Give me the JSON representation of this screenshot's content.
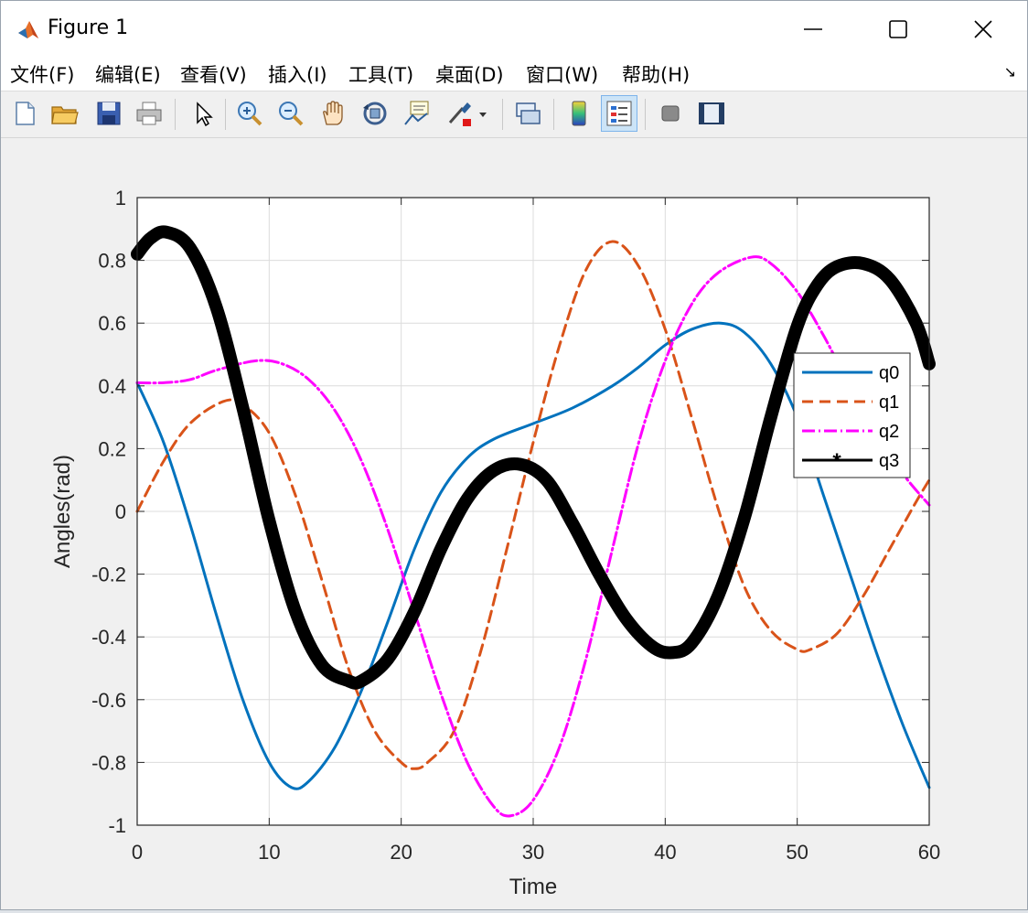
{
  "window": {
    "title": "Figure 1"
  },
  "menu": [
    {
      "label": "文件(F)",
      "key": "F"
    },
    {
      "label": "编辑(E)",
      "key": "E"
    },
    {
      "label": "查看(V)",
      "key": "V"
    },
    {
      "label": "插入(I)",
      "key": "I"
    },
    {
      "label": "工具(T)",
      "key": "T"
    },
    {
      "label": "桌面(D)",
      "key": "D"
    },
    {
      "label": "窗口(W)",
      "key": "W"
    },
    {
      "label": "帮助(H)",
      "key": "H"
    }
  ],
  "toolbar": [
    "new-figure-icon",
    "open-file-icon",
    "save-icon",
    "print-icon",
    "pointer-icon",
    "zoom-in-icon",
    "zoom-out-icon",
    "pan-hand-icon",
    "rotate-3d-icon",
    "data-cursor-icon",
    "brush-icon",
    "link-plot-icon",
    "colorbar-icon",
    "legend-icon",
    "hide-plot-tools-icon",
    "show-plot-tools-icon"
  ],
  "chart_data": {
    "type": "line",
    "title": "",
    "xlabel": "Time",
    "ylabel": "Angles(rad)",
    "xlim": [
      0,
      60
    ],
    "ylim": [
      -1,
      1
    ],
    "xticks": [
      0,
      10,
      20,
      30,
      40,
      50,
      60
    ],
    "yticks": [
      -1,
      -0.8,
      -0.6,
      -0.4,
      -0.2,
      0,
      0.2,
      0.4,
      0.6,
      0.8,
      1
    ],
    "grid": true,
    "legend_position": "top-right",
    "series": [
      {
        "name": "q0",
        "color": "#0072BD",
        "style": "solid",
        "width": 3,
        "points": [
          [
            0,
            0.41
          ],
          [
            2,
            0.22
          ],
          [
            4,
            -0.04
          ],
          [
            6,
            -0.33
          ],
          [
            8,
            -0.6
          ],
          [
            10,
            -0.8
          ],
          [
            11.7,
            -0.88
          ],
          [
            13,
            -0.86
          ],
          [
            15,
            -0.75
          ],
          [
            17,
            -0.57
          ],
          [
            19,
            -0.35
          ],
          [
            21,
            -0.12
          ],
          [
            23,
            0.06
          ],
          [
            25,
            0.17
          ],
          [
            27,
            0.23
          ],
          [
            30,
            0.28
          ],
          [
            33,
            0.33
          ],
          [
            36,
            0.4
          ],
          [
            38,
            0.46
          ],
          [
            40,
            0.53
          ],
          [
            42,
            0.58
          ],
          [
            44.2,
            0.6
          ],
          [
            46,
            0.57
          ],
          [
            48,
            0.47
          ],
          [
            50,
            0.3
          ],
          [
            52,
            0.05
          ],
          [
            54,
            -0.2
          ],
          [
            56,
            -0.45
          ],
          [
            58,
            -0.68
          ],
          [
            60,
            -0.88
          ]
        ]
      },
      {
        "name": "q1",
        "color": "#D95319",
        "style": "dashed",
        "width": 3,
        "points": [
          [
            0,
            0.0
          ],
          [
            2,
            0.16
          ],
          [
            4,
            0.28
          ],
          [
            6.5,
            0.35
          ],
          [
            8,
            0.34
          ],
          [
            10,
            0.25
          ],
          [
            12,
            0.05
          ],
          [
            14,
            -0.22
          ],
          [
            16,
            -0.5
          ],
          [
            18,
            -0.7
          ],
          [
            20,
            -0.8
          ],
          [
            21,
            -0.82
          ],
          [
            22,
            -0.8
          ],
          [
            24,
            -0.7
          ],
          [
            26,
            -0.45
          ],
          [
            28,
            -0.12
          ],
          [
            30,
            0.22
          ],
          [
            32,
            0.53
          ],
          [
            34,
            0.77
          ],
          [
            36,
            0.86
          ],
          [
            38,
            0.78
          ],
          [
            40,
            0.58
          ],
          [
            42,
            0.3
          ],
          [
            44,
            0.01
          ],
          [
            46,
            -0.24
          ],
          [
            48,
            -0.38
          ],
          [
            50,
            -0.44
          ],
          [
            51,
            -0.44
          ],
          [
            53,
            -0.39
          ],
          [
            55,
            -0.27
          ],
          [
            57,
            -0.12
          ],
          [
            59,
            0.03
          ],
          [
            60,
            0.1
          ]
        ]
      },
      {
        "name": "q2",
        "color": "#FF00FF",
        "style": "dashdot",
        "width": 3,
        "points": [
          [
            0,
            0.41
          ],
          [
            2,
            0.41
          ],
          [
            4,
            0.42
          ],
          [
            6,
            0.45
          ],
          [
            9,
            0.48
          ],
          [
            11,
            0.47
          ],
          [
            13,
            0.42
          ],
          [
            15,
            0.32
          ],
          [
            17,
            0.16
          ],
          [
            19,
            -0.06
          ],
          [
            21,
            -0.32
          ],
          [
            23,
            -0.58
          ],
          [
            25,
            -0.8
          ],
          [
            27,
            -0.94
          ],
          [
            28.3,
            -0.97
          ],
          [
            30,
            -0.92
          ],
          [
            32,
            -0.75
          ],
          [
            34,
            -0.47
          ],
          [
            36,
            -0.12
          ],
          [
            38,
            0.22
          ],
          [
            40,
            0.48
          ],
          [
            42,
            0.66
          ],
          [
            44,
            0.76
          ],
          [
            46.5,
            0.81
          ],
          [
            48,
            0.79
          ],
          [
            50,
            0.7
          ],
          [
            52,
            0.56
          ],
          [
            54,
            0.4
          ],
          [
            56,
            0.25
          ],
          [
            58,
            0.12
          ],
          [
            60,
            0.02
          ]
        ]
      },
      {
        "name": "q3",
        "color": "#000000",
        "style": "solid-star",
        "width": 3,
        "points": [
          [
            0,
            0.82
          ],
          [
            1,
            0.87
          ],
          [
            2.2,
            0.89
          ],
          [
            4,
            0.84
          ],
          [
            6,
            0.65
          ],
          [
            8,
            0.33
          ],
          [
            10,
            -0.03
          ],
          [
            12,
            -0.32
          ],
          [
            14,
            -0.49
          ],
          [
            16,
            -0.54
          ],
          [
            17,
            -0.54
          ],
          [
            19,
            -0.47
          ],
          [
            21,
            -0.32
          ],
          [
            23,
            -0.12
          ],
          [
            25,
            0.04
          ],
          [
            27,
            0.13
          ],
          [
            29,
            0.15
          ],
          [
            31,
            0.1
          ],
          [
            33,
            -0.04
          ],
          [
            35,
            -0.2
          ],
          [
            37,
            -0.34
          ],
          [
            39,
            -0.43
          ],
          [
            40.5,
            -0.45
          ],
          [
            42,
            -0.42
          ],
          [
            44,
            -0.27
          ],
          [
            46,
            -0.02
          ],
          [
            48,
            0.3
          ],
          [
            50,
            0.59
          ],
          [
            51.5,
            0.72
          ],
          [
            53,
            0.78
          ],
          [
            55,
            0.79
          ],
          [
            57,
            0.74
          ],
          [
            59,
            0.6
          ],
          [
            60,
            0.47
          ]
        ]
      }
    ]
  }
}
